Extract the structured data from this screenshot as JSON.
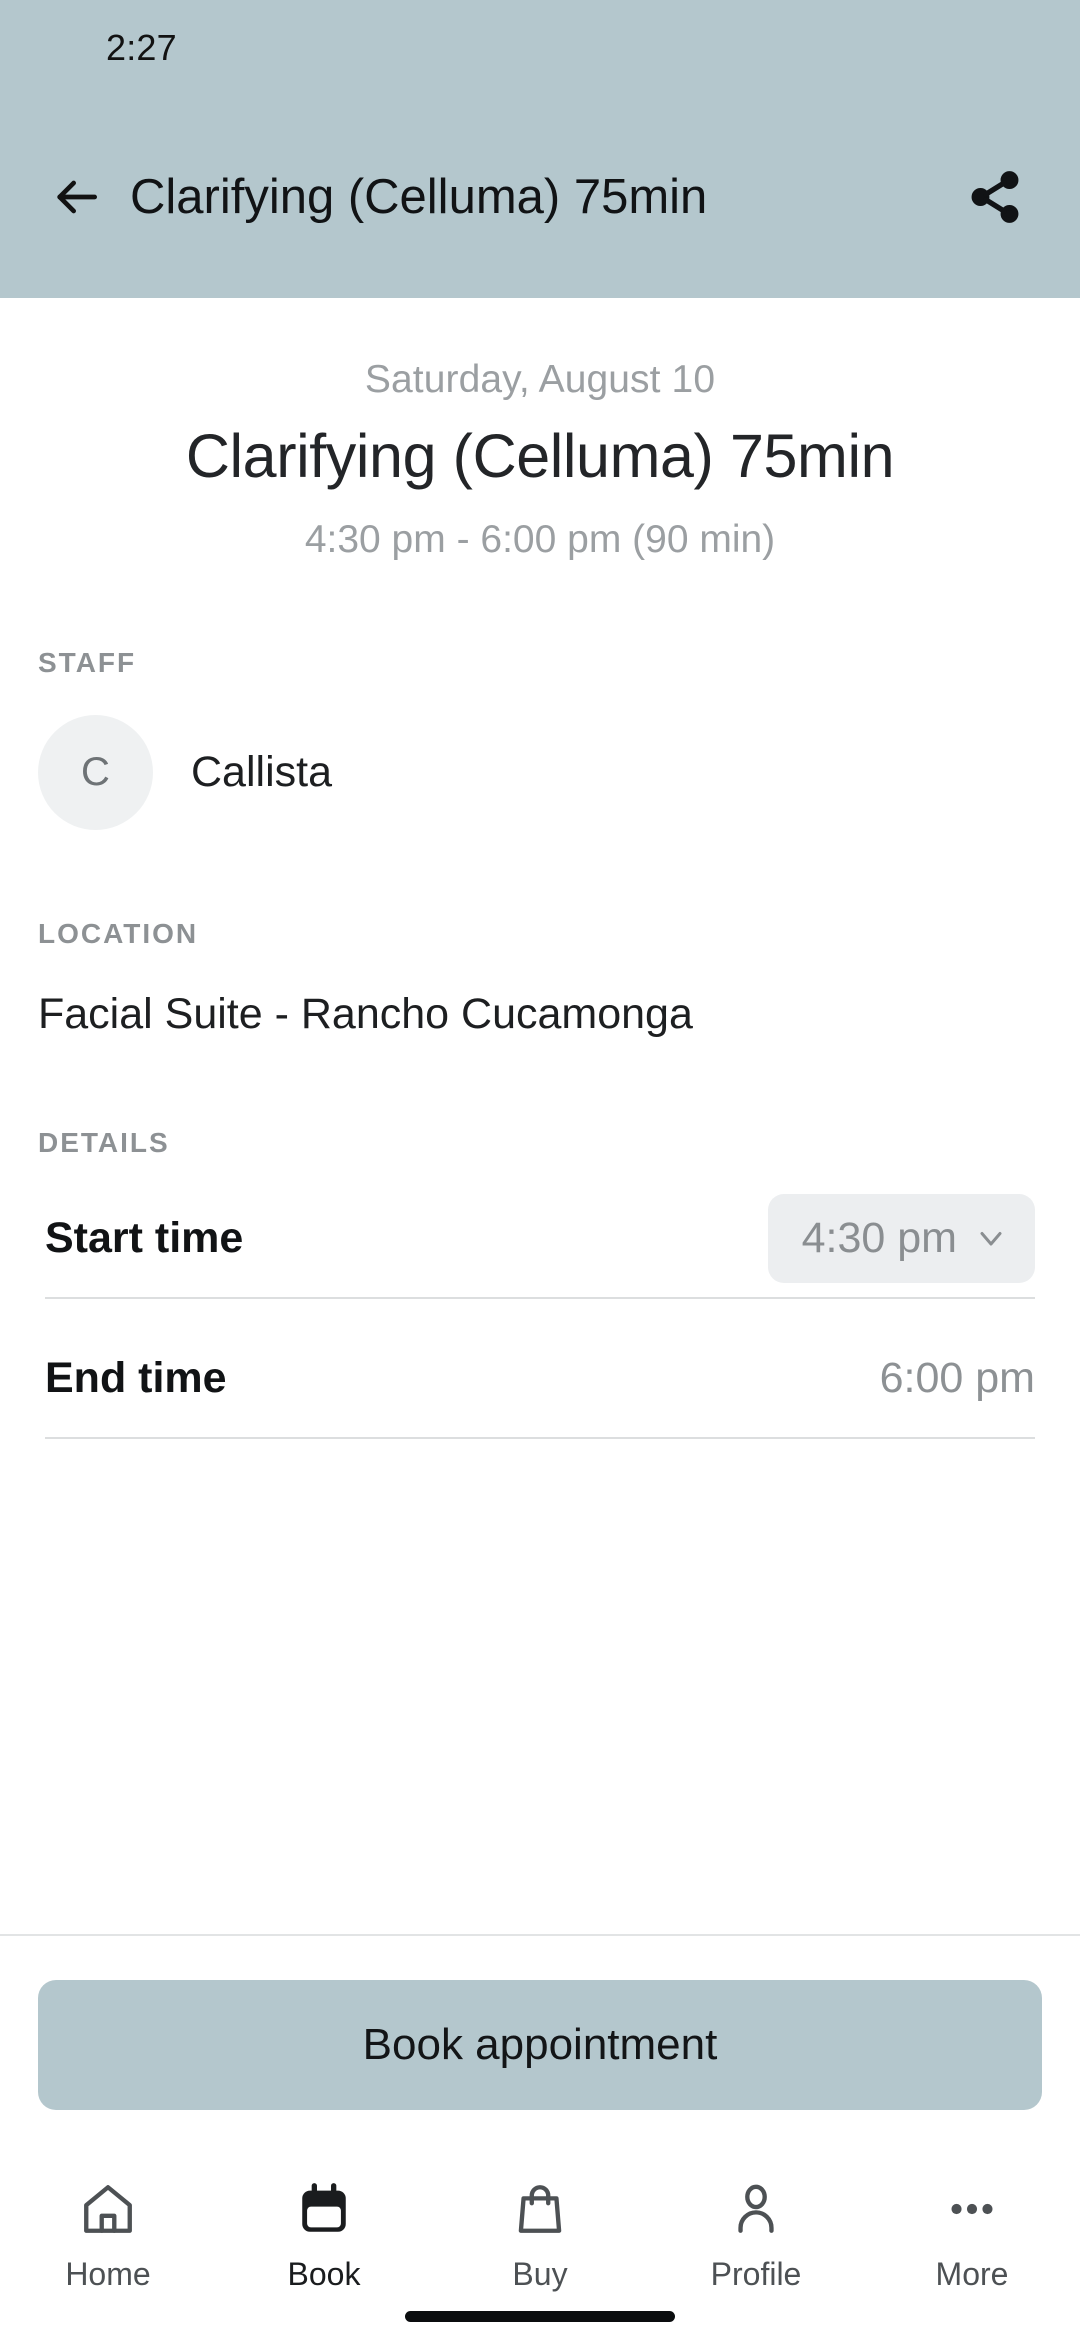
{
  "status_bar": {
    "time": "2:27"
  },
  "app_bar": {
    "back_icon": "arrow-left-icon",
    "title": "Clarifying (Celluma) 75min",
    "share_icon": "share-icon",
    "background_color": "#b4c7cd"
  },
  "hero": {
    "date": "Saturday, August 10",
    "title": "Clarifying (Celluma) 75min",
    "time_range": "4:30 pm - 6:00 pm (90 min)"
  },
  "staff": {
    "section_label": "STAFF",
    "avatar_initial": "C",
    "name": "Callista"
  },
  "location": {
    "section_label": "LOCATION",
    "value": "Facial Suite - Rancho Cucamonga"
  },
  "details": {
    "section_label": "DETAILS",
    "rows": [
      {
        "label": "Start time",
        "value": "4:30 pm",
        "type": "dropdown",
        "icon": "chevron-down-icon"
      },
      {
        "label": "End time",
        "value": "6:00 pm",
        "type": "text"
      }
    ]
  },
  "action": {
    "book_label": "Book appointment",
    "book_color": "#b4c7cd"
  },
  "bottom_nav": {
    "items": [
      {
        "label": "Home",
        "icon": "home-icon",
        "active": false
      },
      {
        "label": "Book",
        "icon": "calendar-icon",
        "active": true
      },
      {
        "label": "Buy",
        "icon": "shopping-bag-icon",
        "active": false
      },
      {
        "label": "Profile",
        "icon": "person-icon",
        "active": false
      },
      {
        "label": "More",
        "icon": "more-horizontal-icon",
        "active": false
      }
    ]
  }
}
